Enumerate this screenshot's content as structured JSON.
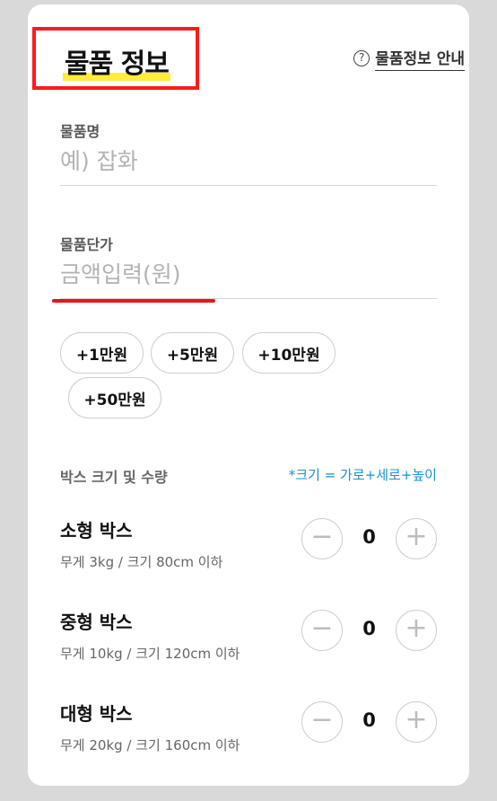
{
  "header": {
    "title": "물품 정보",
    "guide_label": "물품정보 안내",
    "guide_icon": "question-circle-icon"
  },
  "item_name": {
    "label": "물품명",
    "value": "",
    "placeholder": "예) 잡화"
  },
  "unit_price": {
    "label": "물품단가",
    "value": "",
    "placeholder": "금액입력(원)"
  },
  "quick_amounts": [
    "+1만원",
    "+5만원",
    "+10만원",
    "+50만원"
  ],
  "box_section": {
    "label": "박스 크기 및 수량",
    "note": "*크기 = 가로+세로+높이"
  },
  "boxes": [
    {
      "name": "소형 박스",
      "desc": "무게 3kg / 크기 80cm 이하",
      "qty": "0"
    },
    {
      "name": "중형 박스",
      "desc": "무게 10kg / 크기 120cm 이하",
      "qty": "0"
    },
    {
      "name": "대형 박스",
      "desc": "무게 20kg / 크기 160cm 이하",
      "qty": "0"
    }
  ],
  "colors": {
    "highlight": "#ffec3d",
    "annotation_red": "#e8141c",
    "note_blue": "#1a8fd6"
  }
}
